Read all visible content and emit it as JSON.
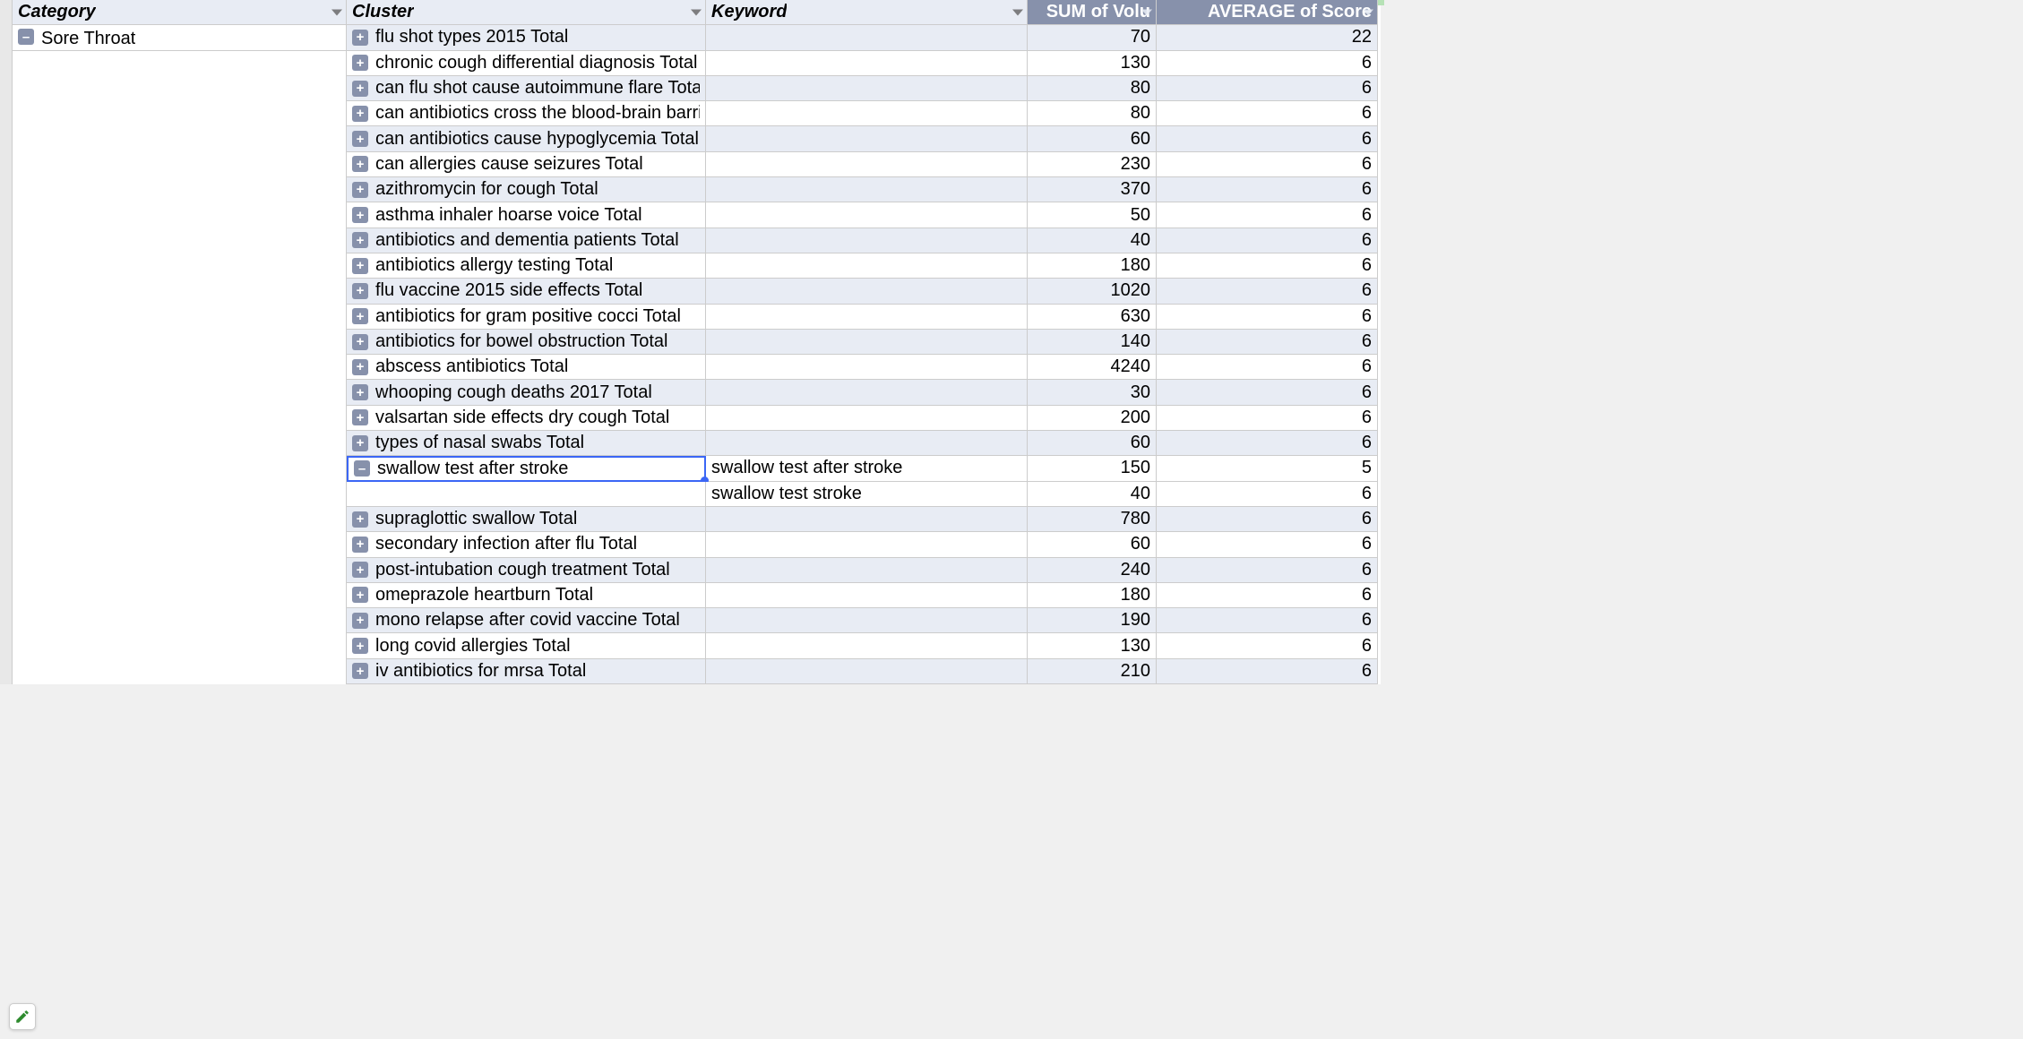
{
  "headers": {
    "category": "Category",
    "cluster": "Cluster",
    "keyword": "Keyword",
    "volume": "SUM of Volu",
    "score": "AVERAGE of Score"
  },
  "category_label": "Sore Throat",
  "rows": [
    {
      "shaded": true,
      "toggle": "plus",
      "cluster": "flu shot types 2015 Total",
      "keyword": "",
      "volume": 70,
      "score": 22
    },
    {
      "shaded": false,
      "toggle": "plus",
      "cluster": "chronic cough differential diagnosis Total",
      "keyword": "",
      "volume": 130,
      "score": 6
    },
    {
      "shaded": true,
      "toggle": "plus",
      "cluster": "can flu shot cause autoimmune flare Total",
      "keyword": "",
      "volume": 80,
      "score": 6
    },
    {
      "shaded": false,
      "toggle": "plus",
      "cluster": "can antibiotics cross the blood-brain barrier Total",
      "keyword": "",
      "volume": 80,
      "score": 6
    },
    {
      "shaded": true,
      "toggle": "plus",
      "cluster": "can antibiotics cause hypoglycemia Total",
      "keyword": "",
      "volume": 60,
      "score": 6
    },
    {
      "shaded": false,
      "toggle": "plus",
      "cluster": "can allergies cause seizures Total",
      "keyword": "",
      "volume": 230,
      "score": 6
    },
    {
      "shaded": true,
      "toggle": "plus",
      "cluster": "azithromycin for cough Total",
      "keyword": "",
      "volume": 370,
      "score": 6
    },
    {
      "shaded": false,
      "toggle": "plus",
      "cluster": "asthma inhaler hoarse voice Total",
      "keyword": "",
      "volume": 50,
      "score": 6
    },
    {
      "shaded": true,
      "toggle": "plus",
      "cluster": "antibiotics and dementia patients Total",
      "keyword": "",
      "volume": 40,
      "score": 6
    },
    {
      "shaded": false,
      "toggle": "plus",
      "cluster": "antibiotics allergy testing Total",
      "keyword": "",
      "volume": 180,
      "score": 6
    },
    {
      "shaded": true,
      "toggle": "plus",
      "cluster": "flu vaccine 2015 side effects Total",
      "keyword": "",
      "volume": 1020,
      "score": 6
    },
    {
      "shaded": false,
      "toggle": "plus",
      "cluster": "antibiotics for gram positive cocci Total",
      "keyword": "",
      "volume": 630,
      "score": 6
    },
    {
      "shaded": true,
      "toggle": "plus",
      "cluster": "antibiotics for bowel obstruction Total",
      "keyword": "",
      "volume": 140,
      "score": 6
    },
    {
      "shaded": false,
      "toggle": "plus",
      "cluster": "abscess antibiotics Total",
      "keyword": "",
      "volume": 4240,
      "score": 6
    },
    {
      "shaded": true,
      "toggle": "plus",
      "cluster": "whooping cough deaths 2017 Total",
      "keyword": "",
      "volume": 30,
      "score": 6
    },
    {
      "shaded": false,
      "toggle": "plus",
      "cluster": "valsartan side effects dry cough Total",
      "keyword": "",
      "volume": 200,
      "score": 6
    },
    {
      "shaded": true,
      "toggle": "plus",
      "cluster": "types of nasal swabs Total",
      "keyword": "",
      "volume": 60,
      "score": 6
    },
    {
      "shaded": false,
      "toggle": "minus",
      "cluster": "swallow test after stroke",
      "selected": true,
      "keyword": "swallow test after stroke",
      "volume": 150,
      "score": 5
    },
    {
      "shaded": false,
      "toggle": "",
      "cluster": "",
      "keyword": "swallow test stroke",
      "volume": 40,
      "score": 6
    },
    {
      "shaded": true,
      "toggle": "plus",
      "cluster": "supraglottic swallow Total",
      "keyword": "",
      "volume": 780,
      "score": 6
    },
    {
      "shaded": false,
      "toggle": "plus",
      "cluster": "secondary infection after flu Total",
      "keyword": "",
      "volume": 60,
      "score": 6
    },
    {
      "shaded": true,
      "toggle": "plus",
      "cluster": "post-intubation cough treatment Total",
      "keyword": "",
      "volume": 240,
      "score": 6
    },
    {
      "shaded": false,
      "toggle": "plus",
      "cluster": "omeprazole heartburn Total",
      "keyword": "",
      "volume": 180,
      "score": 6
    },
    {
      "shaded": true,
      "toggle": "plus",
      "cluster": "mono relapse after covid vaccine Total",
      "keyword": "",
      "volume": 190,
      "score": 6
    },
    {
      "shaded": false,
      "toggle": "plus",
      "cluster": "long covid allergies Total",
      "keyword": "",
      "volume": 130,
      "score": 6
    },
    {
      "shaded": true,
      "toggle": "plus",
      "cluster": "iv antibiotics for mrsa Total",
      "keyword": "",
      "volume": 210,
      "score": 6
    }
  ]
}
